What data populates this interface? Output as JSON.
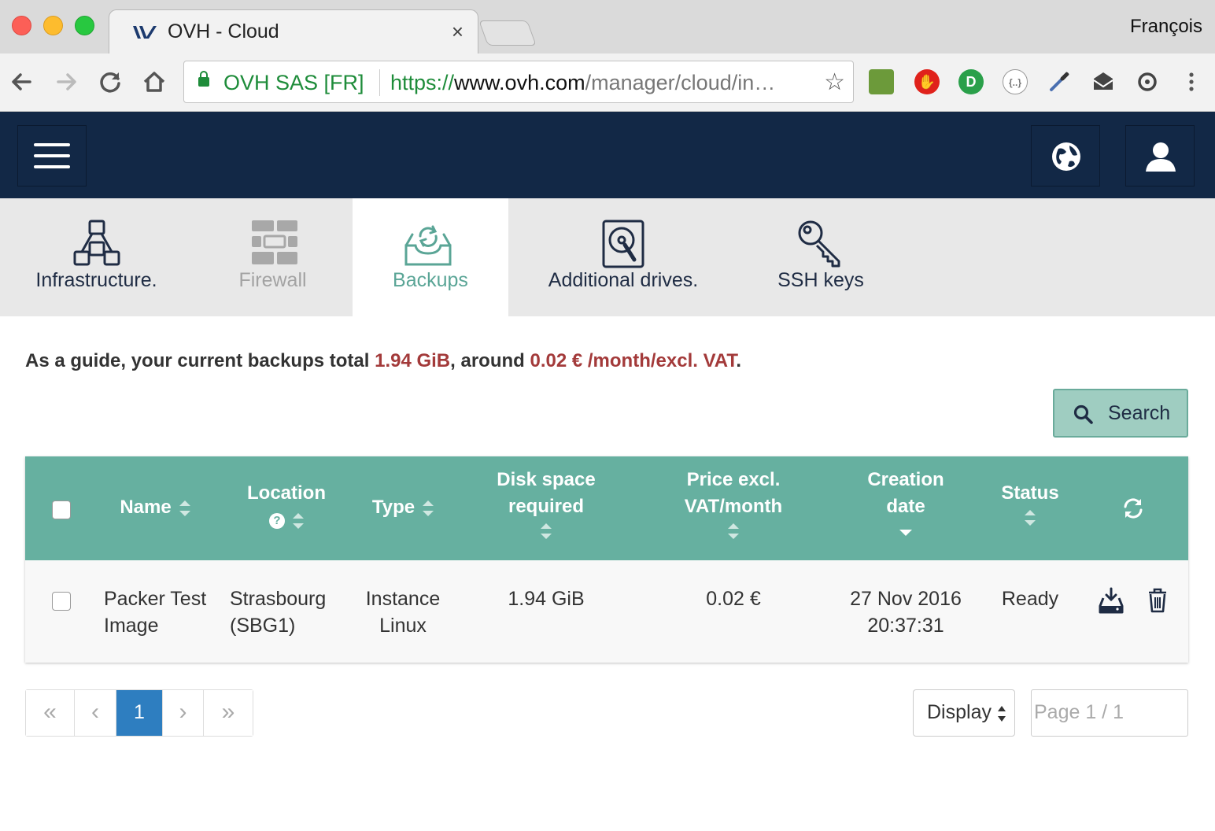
{
  "browser": {
    "tab_title": "OVH - Cloud",
    "tab_close": "×",
    "profile_name": "François",
    "secure_label": "OVH SAS [FR]",
    "url_scheme": "https://",
    "url_host": "www.ovh.com",
    "url_path": "/manager/cloud/in…",
    "extension_icons": [
      "screen-extension-icon",
      "adblock-icon",
      "idcheck-icon",
      "json-viewer-icon",
      "eyedropper-icon",
      "mail-icon",
      "sync-icon"
    ]
  },
  "nav_tabs": [
    {
      "label": "Infrastructure.",
      "icon": "infrastructure-icon",
      "state": "normal"
    },
    {
      "label": "Firewall",
      "icon": "firewall-icon",
      "state": "disabled"
    },
    {
      "label": "Backups",
      "icon": "backups-icon",
      "state": "active"
    },
    {
      "label": "Additional drives.",
      "icon": "drive-icon",
      "state": "normal"
    },
    {
      "label": "SSH keys",
      "icon": "key-icon",
      "state": "normal"
    }
  ],
  "guide": {
    "prefix": "As a guide, your current backups total ",
    "total_size": "1.94 GiB",
    "middle": ", around ",
    "price": "0.02 € /month/excl. VAT",
    "suffix": "."
  },
  "search_button": "Search",
  "table": {
    "headers": {
      "name": "Name",
      "location": "Location",
      "type": "Type",
      "disk_line1": "Disk space",
      "disk_line2": "required",
      "price_line1": "Price excl.",
      "price_line2": "VAT/month",
      "date_line1": "Creation",
      "date_line2": "date",
      "status": "Status",
      "help_glyph": "?"
    },
    "rows": [
      {
        "name_line1": "Packer Test",
        "name_line2": "Image",
        "location_line1": "Strasbourg",
        "location_line2": "(SBG1)",
        "type_line1": "Instance",
        "type_line2": "Linux",
        "disk": "1.94 GiB",
        "price": "0.02 €",
        "date_line1": "27 Nov 2016",
        "date_line2": "20:37:31",
        "status": "Ready"
      }
    ]
  },
  "pagination": {
    "first": "«",
    "prev": "‹",
    "current": "1",
    "next": "›",
    "last": "»"
  },
  "display_select": "Display",
  "page_input_placeholder": "Page 1 / 1",
  "colors": {
    "appbar": "#122846",
    "table_header": "#66b0a0",
    "accent_text": "#a33a3a",
    "active_page": "#2e7ec0"
  }
}
